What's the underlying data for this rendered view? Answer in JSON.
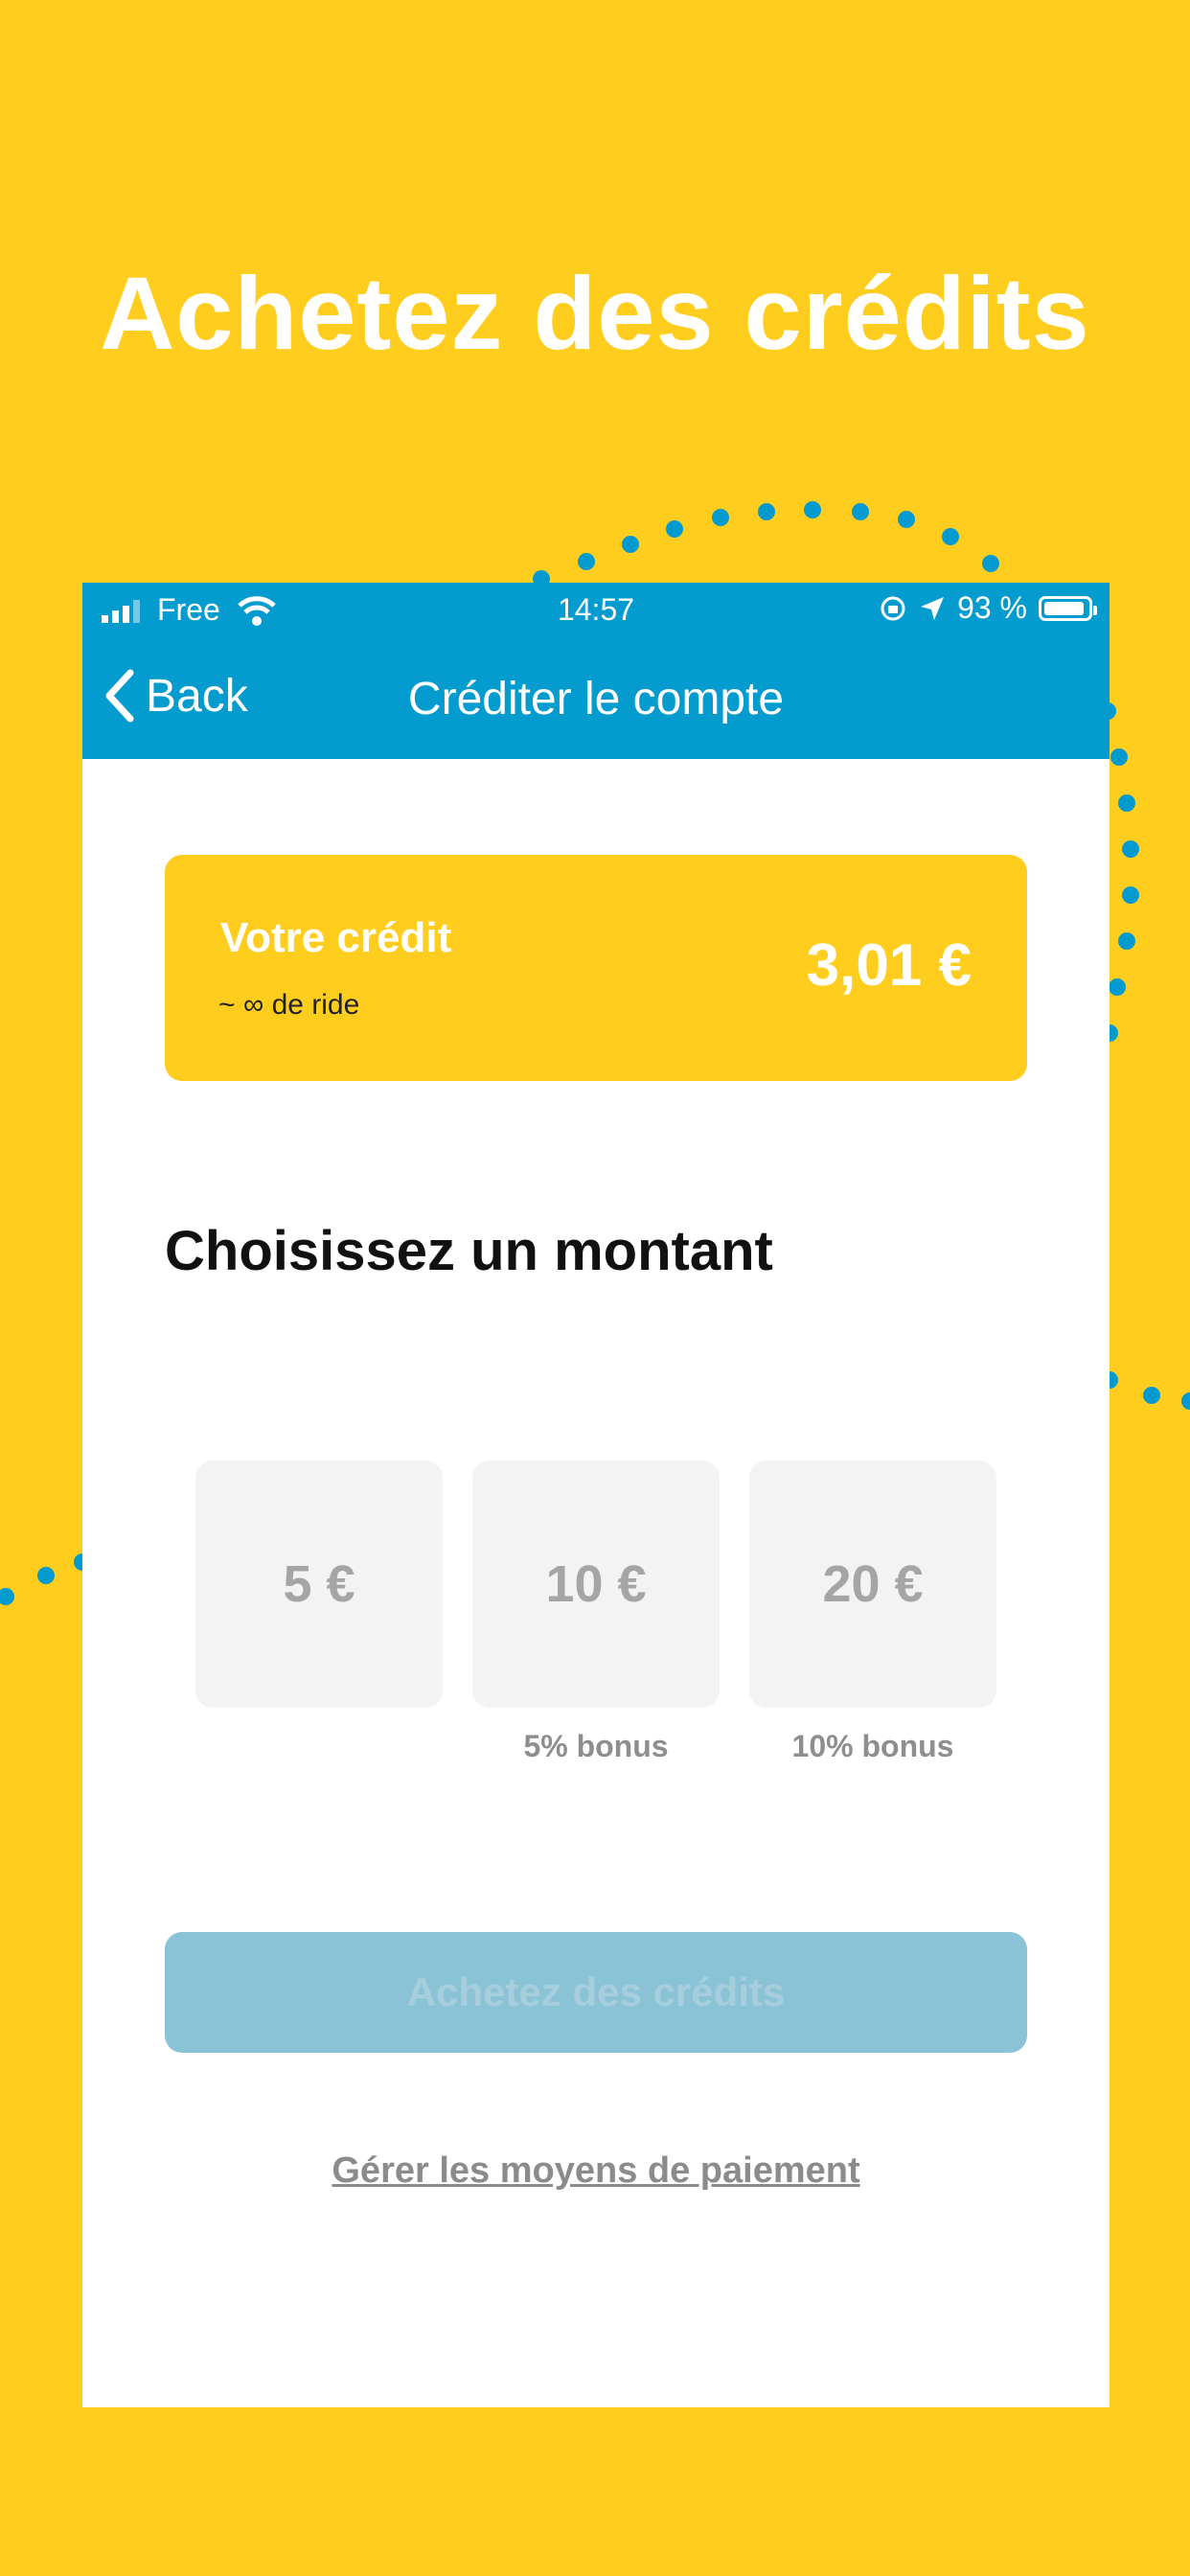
{
  "headline": "Achetez des crédits",
  "status_bar": {
    "carrier": "Free",
    "time": "14:57",
    "battery": "93 %"
  },
  "nav": {
    "back_label": "Back",
    "title": "Créditer le compte"
  },
  "credit": {
    "label": "Votre crédit",
    "subtext": "~ ∞ de ride",
    "amount": "3,01 €"
  },
  "choose": {
    "title": "Choisissez un montant",
    "options": [
      {
        "label": "5 €",
        "bonus": ""
      },
      {
        "label": "10 €",
        "bonus": "5% bonus"
      },
      {
        "label": "20 €",
        "bonus": "10% bonus"
      }
    ]
  },
  "buy_button": "Achetez des crédits",
  "manage_link": "Gérer les moyens de paiement",
  "colors": {
    "background": "#FFCD1E",
    "topbar": "#049CCF",
    "dots": "#039AD0",
    "button_disabled": "#8AC3D6"
  }
}
